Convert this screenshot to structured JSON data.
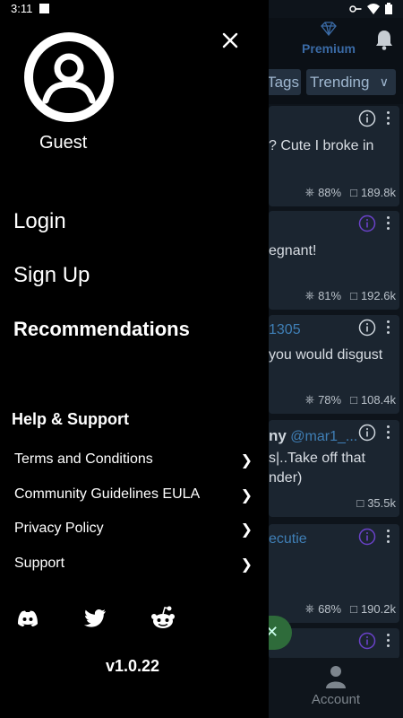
{
  "status_bar": {
    "time": "3:11"
  },
  "background": {
    "premium_label": "Premium",
    "tags_label": "Tags",
    "trending_label": "Trending",
    "cards": [
      {
        "text": "? Cute I broke in",
        "likes": "88%",
        "comments": "189.8k"
      },
      {
        "text": "egnant!",
        "likes": "81%",
        "comments": "192.6k"
      },
      {
        "handle": "1305",
        "text": "you would disgust",
        "likes": "78%",
        "comments": "108.4k"
      },
      {
        "name": "ny",
        "handle": "@mar1_...",
        "text": "s|..Take off that",
        "text2": "nder)",
        "comments": "35.5k"
      },
      {
        "handle": "ecutie",
        "likes": "68%",
        "comments": "190.2k"
      }
    ],
    "account_label": "Account"
  },
  "drawer": {
    "user_name": "Guest",
    "login": "Login",
    "signup": "Sign Up",
    "recommendations": "Recommendations",
    "help_heading": "Help & Support",
    "links": [
      "Terms and Conditions",
      "Community Guidelines EULA",
      "Privacy Policy",
      "Support"
    ],
    "version": "v1.0.22"
  },
  "icons": [
    "close-icon",
    "user-avatar-icon",
    "discord-icon",
    "twitter-icon",
    "reddit-icon",
    "diamond-icon",
    "bell-icon",
    "info-icon",
    "more-vert-icon",
    "account-icon"
  ]
}
